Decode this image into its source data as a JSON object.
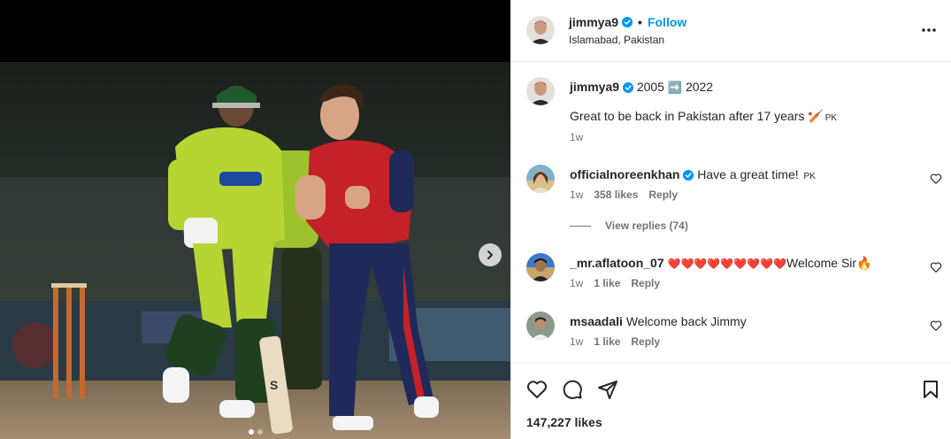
{
  "post": {
    "username": "jimmya9",
    "follow_label": "Follow",
    "separator": "•",
    "location": "Islamabad, Pakistan",
    "caption_line1_prefix": "2005",
    "caption_line1_suffix": "2022",
    "caption_line1_arrow": "➡️",
    "caption_line2": "Great to be back in Pakistan after 17 years",
    "caption_line2_emoji": "🏏",
    "caption_line2_flag": "PK",
    "caption_time": "1w",
    "likes": "147,227 likes"
  },
  "comments": [
    {
      "username": "officialnoreenkhan",
      "text": "Have a great time!",
      "flag": "PK",
      "time": "1w",
      "likes": "358 likes",
      "reply_label": "Reply",
      "view_replies": "View replies (74)"
    },
    {
      "username": "_mr.aflatoon_07",
      "hearts": "❤️❤️❤️❤️❤️❤️❤️❤️❤️",
      "text": "Welcome Sir",
      "emoji": "🔥",
      "time": "1w",
      "likes": "1 like",
      "reply_label": "Reply"
    },
    {
      "username": "msaadali",
      "text": "Welcome back Jimmy",
      "time": "1w",
      "likes": "1 like",
      "reply_label": "Reply"
    }
  ],
  "media": {
    "slide_count": 2,
    "active_slide": 1
  },
  "colors": {
    "accent_blue": "#0095f6",
    "muted_text": "#737373",
    "border": "#efefef"
  },
  "icons": [
    "verified-icon",
    "more-options-icon",
    "heart-icon",
    "comment-icon",
    "share-icon",
    "save-icon",
    "next-arrow-icon"
  ]
}
